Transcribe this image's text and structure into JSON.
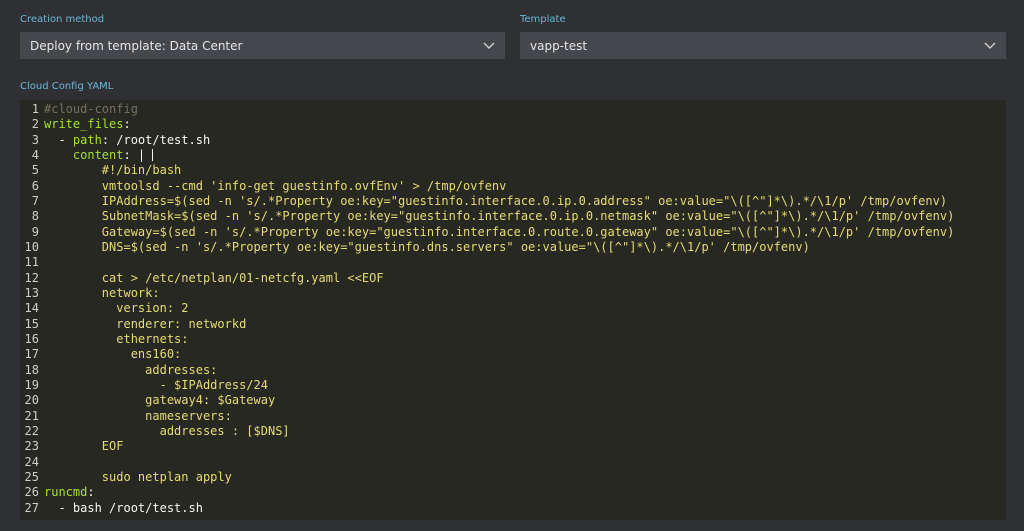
{
  "creation_method": {
    "label": "Creation method",
    "value": "Deploy from template: Data Center",
    "icon": "chevron-down-icon"
  },
  "template": {
    "label": "Template",
    "value": "vapp-test",
    "icon": "chevron-down-icon"
  },
  "cloud_config": {
    "label": "Cloud Config YAML",
    "lines": [
      {
        "n": "1",
        "parts": [
          {
            "t": "#cloud-config",
            "c": "c"
          }
        ]
      },
      {
        "n": "2",
        "parts": [
          {
            "t": "write_files",
            "c": "k"
          },
          {
            "t": ":",
            "c": "w"
          }
        ]
      },
      {
        "n": "3",
        "parts": [
          {
            "t": "  - ",
            "c": "w"
          },
          {
            "t": "path",
            "c": "k"
          },
          {
            "t": ": /root/test.sh",
            "c": "w"
          }
        ]
      },
      {
        "n": "4",
        "parts": [
          {
            "t": "    ",
            "c": "w"
          },
          {
            "t": "content",
            "c": "k"
          },
          {
            "t": ": |",
            "c": "w"
          }
        ]
      },
      {
        "n": "5",
        "parts": [
          {
            "t": "        #!/bin/bash",
            "c": "y"
          }
        ]
      },
      {
        "n": "6",
        "parts": [
          {
            "t": "        vmtoolsd --cmd 'info-get guestinfo.ovfEnv' > /tmp/ovfenv",
            "c": "y"
          }
        ]
      },
      {
        "n": "7",
        "parts": [
          {
            "t": "        IPAddress=$(sed -n 's/.*Property oe:key=\"guestinfo.interface.0.ip.0.address\" oe:value=\"\\([^\"]*\\).*/\\1/p' /tmp/ovfenv)",
            "c": "y"
          }
        ]
      },
      {
        "n": "8",
        "parts": [
          {
            "t": "        SubnetMask=$(sed -n 's/.*Property oe:key=\"guestinfo.interface.0.ip.0.netmask\" oe:value=\"\\([^\"]*\\).*/\\1/p' /tmp/ovfenv)",
            "c": "y"
          }
        ]
      },
      {
        "n": "9",
        "parts": [
          {
            "t": "        Gateway=$(sed -n 's/.*Property oe:key=\"guestinfo.interface.0.route.0.gateway\" oe:value=\"\\([^\"]*\\).*/\\1/p' /tmp/ovfenv)",
            "c": "y"
          }
        ]
      },
      {
        "n": "10",
        "parts": [
          {
            "t": "        DNS=$(sed -n 's/.*Property oe:key=\"guestinfo.dns.servers\" oe:value=\"\\([^\"]*\\).*/\\1/p' /tmp/ovfenv)",
            "c": "y"
          }
        ]
      },
      {
        "n": "11",
        "parts": []
      },
      {
        "n": "12",
        "parts": [
          {
            "t": "        cat > /etc/netplan/01-netcfg.yaml <<EOF",
            "c": "y"
          }
        ]
      },
      {
        "n": "13",
        "parts": [
          {
            "t": "        network:",
            "c": "y"
          }
        ]
      },
      {
        "n": "14",
        "parts": [
          {
            "t": "          version: 2",
            "c": "y"
          }
        ]
      },
      {
        "n": "15",
        "parts": [
          {
            "t": "          renderer: networkd",
            "c": "y"
          }
        ]
      },
      {
        "n": "16",
        "parts": [
          {
            "t": "          ethernets:",
            "c": "y"
          }
        ]
      },
      {
        "n": "17",
        "parts": [
          {
            "t": "            ens160:",
            "c": "y"
          }
        ]
      },
      {
        "n": "18",
        "parts": [
          {
            "t": "              addresses:",
            "c": "y"
          }
        ]
      },
      {
        "n": "19",
        "parts": [
          {
            "t": "                - $IPAddress/24",
            "c": "y"
          }
        ]
      },
      {
        "n": "20",
        "parts": [
          {
            "t": "              gateway4: $Gateway",
            "c": "y"
          }
        ]
      },
      {
        "n": "21",
        "parts": [
          {
            "t": "              nameservers:",
            "c": "y"
          }
        ]
      },
      {
        "n": "22",
        "parts": [
          {
            "t": "                addresses : [$DNS]",
            "c": "y"
          }
        ]
      },
      {
        "n": "23",
        "parts": [
          {
            "t": "        EOF",
            "c": "y"
          }
        ]
      },
      {
        "n": "24",
        "parts": []
      },
      {
        "n": "25",
        "parts": [
          {
            "t": "        sudo netplan apply",
            "c": "y"
          }
        ]
      },
      {
        "n": "26",
        "parts": [
          {
            "t": "runcmd",
            "c": "k"
          },
          {
            "t": ":",
            "c": "w"
          }
        ]
      },
      {
        "n": "27",
        "parts": [
          {
            "t": "  - bash /root/test.sh",
            "c": "w"
          }
        ]
      }
    ]
  }
}
